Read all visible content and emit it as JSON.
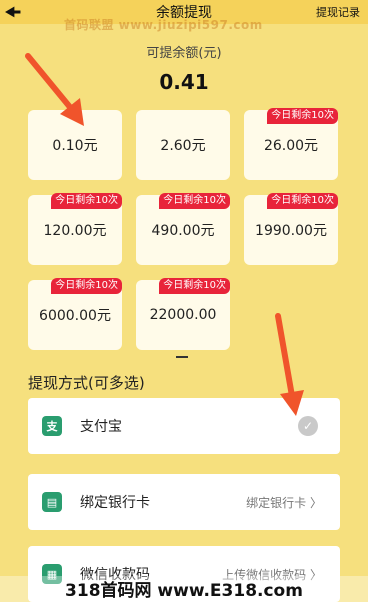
{
  "header": {
    "title": "余额提现",
    "records_link": "提现记录"
  },
  "watermark": "首码联盟 www.jiuzipi597.com",
  "balance": {
    "label": "可提余额(元)",
    "amount": "0.41"
  },
  "options": [
    {
      "amount": "0.10元",
      "badge": ""
    },
    {
      "amount": "2.60元",
      "badge": ""
    },
    {
      "amount": "26.00元",
      "badge": "今日剩余10次"
    },
    {
      "amount": "120.00元",
      "badge": "今日剩余10次"
    },
    {
      "amount": "490.00元",
      "badge": "今日剩余10次"
    },
    {
      "amount": "1990.00元",
      "badge": "今日剩余10次"
    },
    {
      "amount": "6000.00元",
      "badge": "今日剩余10次"
    },
    {
      "amount": "22000.00",
      "badge": "今日剩余10次"
    }
  ],
  "methods": {
    "title": "提现方式(可多选)",
    "items": [
      {
        "label": "支付宝",
        "action": "",
        "icon": "alipay-icon",
        "color": "#2a9d6f"
      },
      {
        "label": "绑定银行卡",
        "action": "绑定银行卡 〉",
        "icon": "bank-card-icon",
        "color": "#2a9d6f"
      },
      {
        "label": "微信收款码",
        "action": "上传微信收款码 〉",
        "icon": "qr-code-icon",
        "color": "#2a9d6f"
      }
    ]
  },
  "footer_watermark": "318首码网 www.E318.com"
}
